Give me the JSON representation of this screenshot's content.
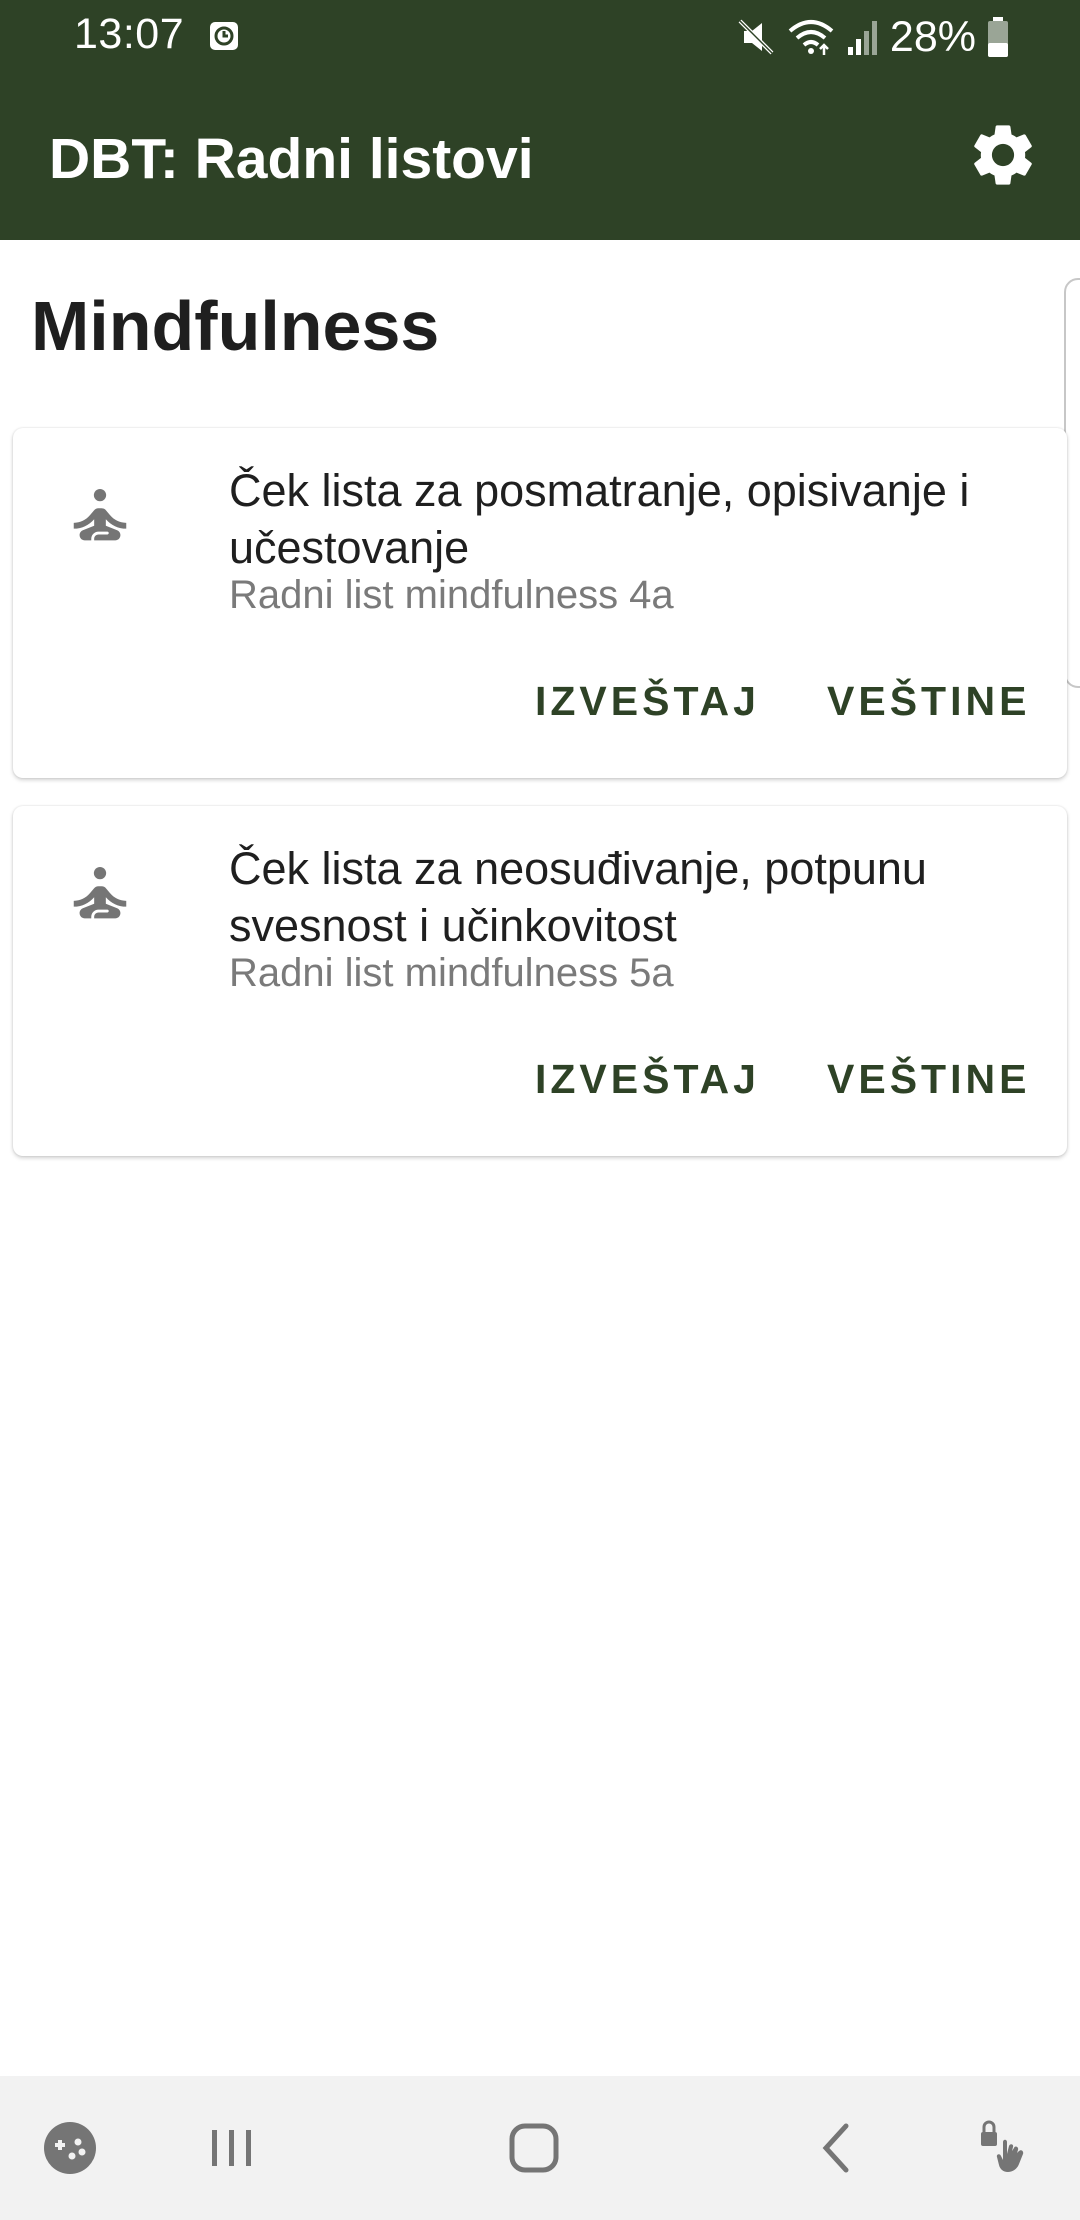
{
  "status_bar": {
    "time": "13:07",
    "battery": "28%",
    "icons": [
      "alarm-icon",
      "mute-icon",
      "wifi-icon",
      "signal-icon",
      "battery-icon"
    ]
  },
  "app_bar": {
    "title": "DBT: Radni listovi",
    "settings_icon": "gear-icon"
  },
  "section": {
    "title": "Mindfulness"
  },
  "cards": [
    {
      "icon": "meditation-icon",
      "title": "Ček lista za posmatranje, opisivanje i učestovanje",
      "subtitle": "Radni list mindfulness 4a",
      "report_label": "IZVEŠTAJ",
      "skills_label": "VEŠTINE"
    },
    {
      "icon": "meditation-icon",
      "title": "Ček lista za neosuđivanje, potpunu svesnost i učinkovitost",
      "subtitle": "Radni list mindfulness 5a",
      "report_label": "IZVEŠTAJ",
      "skills_label": "VEŠTINE"
    }
  ],
  "nav_bar": {
    "icons": [
      "game-icon",
      "recents-icon",
      "home-icon",
      "back-icon",
      "touch-lock-icon"
    ]
  },
  "colors": {
    "primary": "#2e4226",
    "text": "#1f1f1f",
    "secondary_text": "#7a7a7a",
    "nav_background": "#f2f2f2"
  }
}
